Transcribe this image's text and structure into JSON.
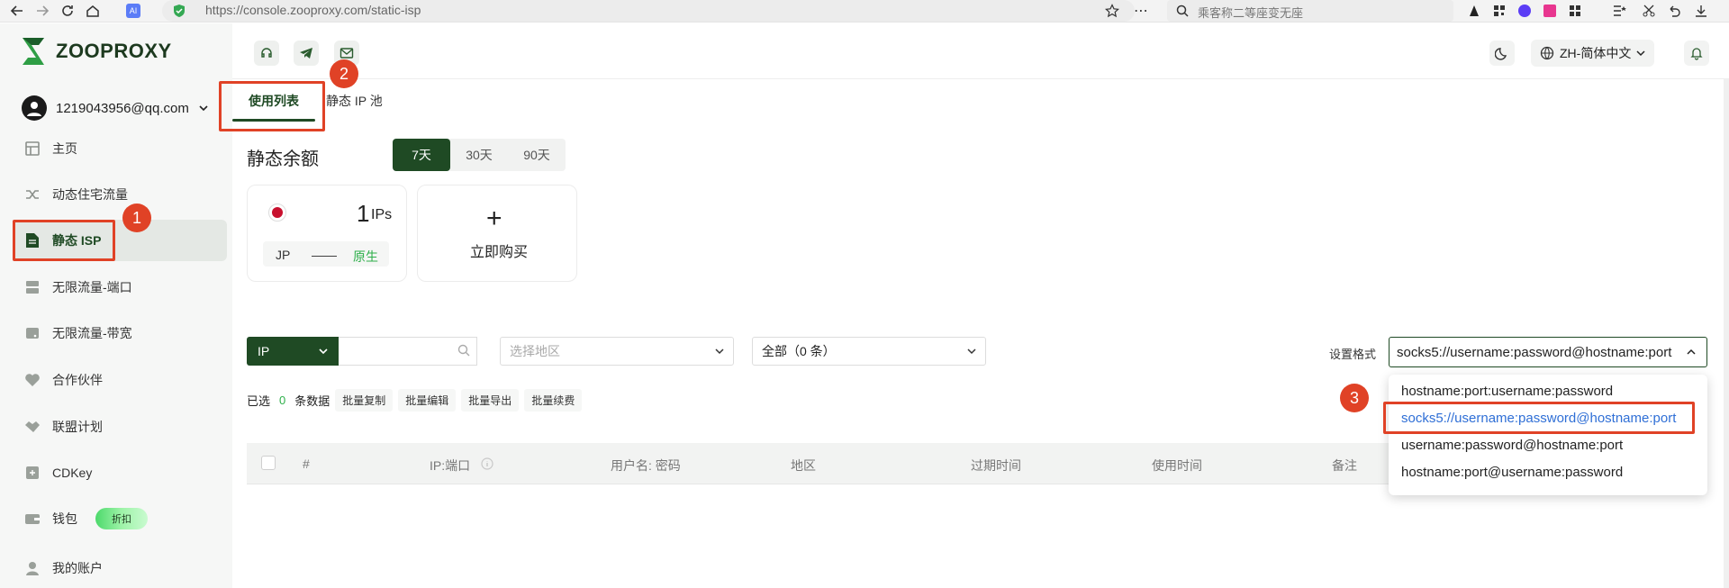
{
  "browser": {
    "url": "https://console.zooproxy.com/static-isp",
    "search_placeholder": "乘客称二等座变无座"
  },
  "brand": {
    "name": "ZOOPROXY",
    "color": "#1f4a24"
  },
  "account": {
    "email": "1219043956@qq.com"
  },
  "sidebar": {
    "items": [
      {
        "label": "主页",
        "icon": "home-icon"
      },
      {
        "label": "动态住宅流量",
        "icon": "shuffle-icon"
      },
      {
        "label": "静态 ISP",
        "icon": "document-icon",
        "active": true
      },
      {
        "label": "无限流量-端口",
        "icon": "server-icon"
      },
      {
        "label": "无限流量-带宽",
        "icon": "drive-icon"
      },
      {
        "label": "合作伙伴",
        "icon": "heart-icon"
      },
      {
        "label": "联盟计划",
        "icon": "handshake-icon"
      },
      {
        "label": "CDKey",
        "icon": "key-icon"
      },
      {
        "label": "钱包",
        "icon": "wallet-icon",
        "badge": "折扣"
      },
      {
        "label": "我的账户",
        "icon": "user-icon"
      }
    ]
  },
  "header": {
    "language": "ZH-简体中文"
  },
  "tabs": [
    {
      "label": "使用列表",
      "active": true
    },
    {
      "label": "静态 IP 池",
      "active": false
    }
  ],
  "balance": {
    "title": "静态余额",
    "periods": [
      "7天",
      "30天",
      "90天"
    ],
    "active_period": "7天",
    "card": {
      "count": "1",
      "unit": "IPs",
      "country": "JP",
      "separator": "——",
      "type": "原生"
    },
    "buy": {
      "plus": "+",
      "label": "立即购买"
    }
  },
  "filters": {
    "ip_select": "IP",
    "region_placeholder": "选择地区",
    "status": "全部（0 条）",
    "format_label": "设置格式",
    "format_value": "socks5://username:password@hostname:port"
  },
  "selection": {
    "prefix": "已选",
    "count": "0",
    "suffix": "条数据",
    "actions": [
      "批量复制",
      "批量编辑",
      "批量导出",
      "批量续费"
    ]
  },
  "table": {
    "columns": [
      "#",
      "IP:端口",
      "用户名: 密码",
      "地区",
      "过期时间",
      "使用时间",
      "备注"
    ]
  },
  "format_options": [
    "hostname:port:username:password",
    "socks5://username:password@hostname:port",
    "username:password@hostname:port",
    "hostname:port@username:password"
  ],
  "annotations": [
    "1",
    "2",
    "3"
  ]
}
